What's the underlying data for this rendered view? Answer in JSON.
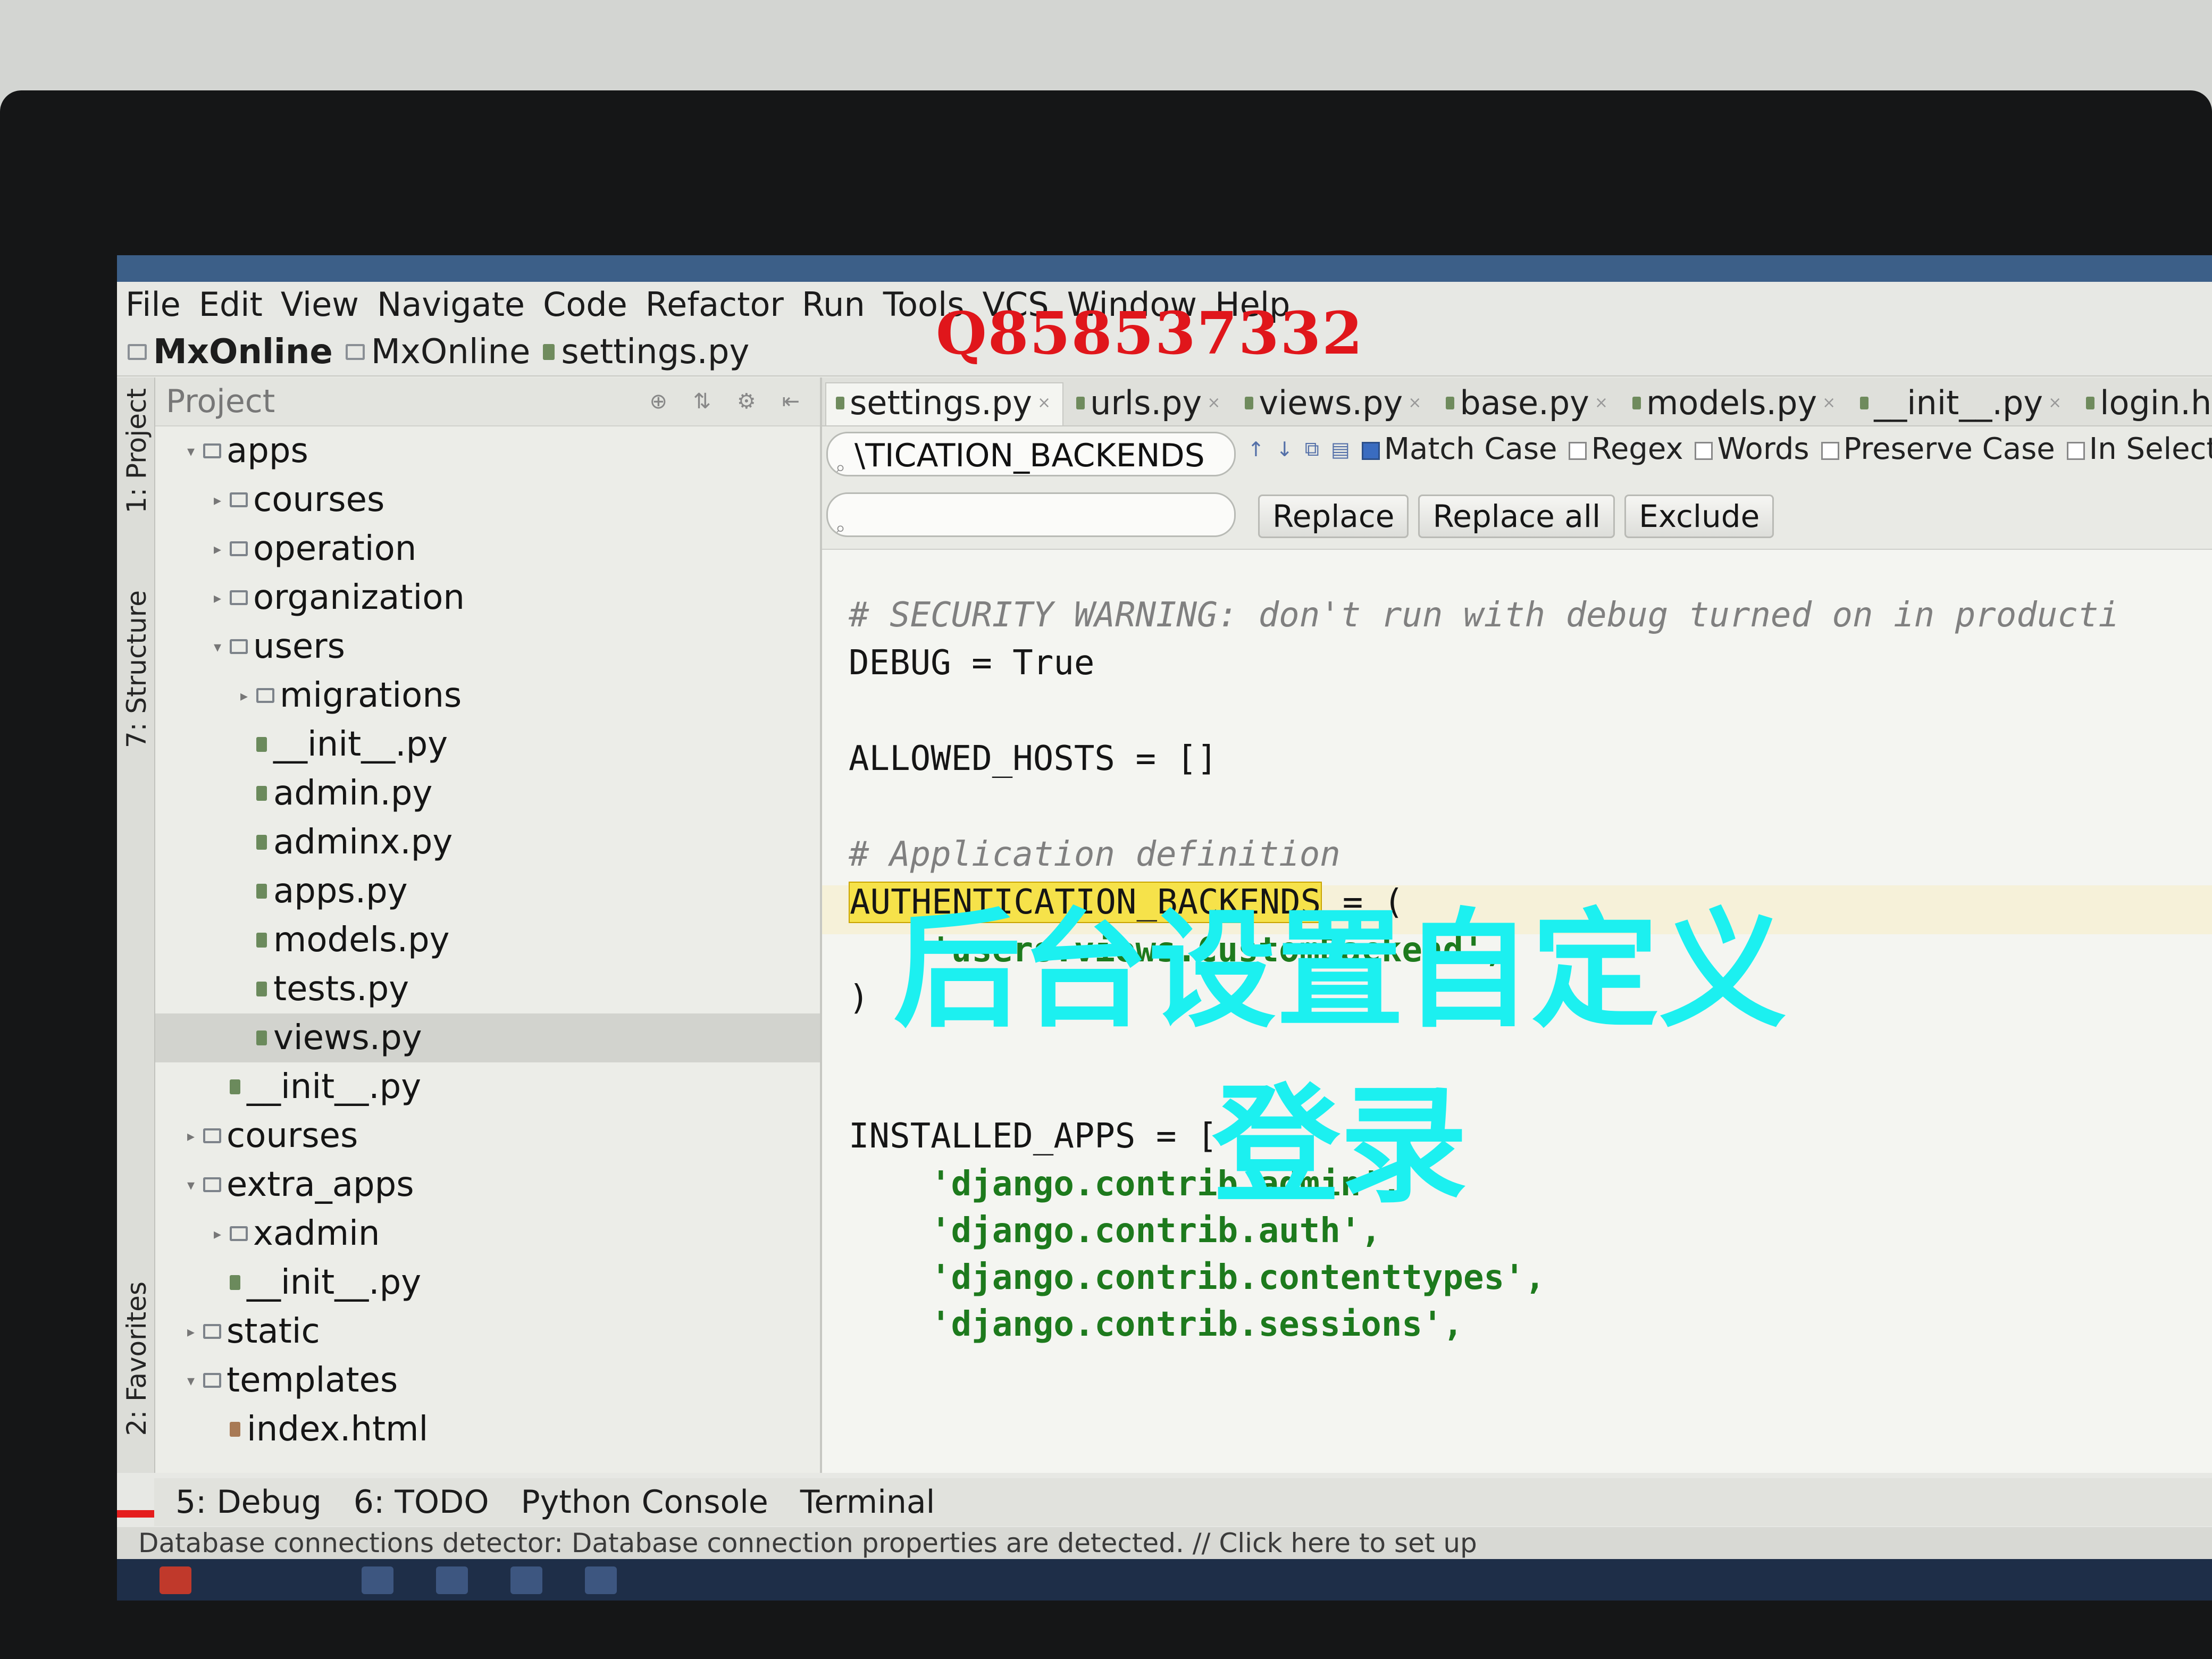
{
  "menu": [
    "File",
    "Edit",
    "View",
    "Navigate",
    "Code",
    "Refactor",
    "Run",
    "Tools",
    "VCS",
    "Window",
    "Help"
  ],
  "watermark_qq": "Q858537332",
  "breadcrumb": [
    "MxOnline",
    "MxOnline",
    "settings.py"
  ],
  "side_tabs": {
    "project": "1: Project",
    "structure": "7: Structure",
    "favorites": "2: Favorites"
  },
  "project_panel": {
    "title": "Project",
    "tree": [
      {
        "label": "apps",
        "type": "folder",
        "level": 0,
        "expanded": true
      },
      {
        "label": "courses",
        "type": "folder",
        "level": 1
      },
      {
        "label": "operation",
        "type": "folder",
        "level": 1
      },
      {
        "label": "organization",
        "type": "folder",
        "level": 1
      },
      {
        "label": "users",
        "type": "folder",
        "level": 1,
        "expanded": true
      },
      {
        "label": "migrations",
        "type": "folder",
        "level": 2
      },
      {
        "label": "__init__.py",
        "type": "file",
        "level": 2
      },
      {
        "label": "admin.py",
        "type": "file",
        "level": 2
      },
      {
        "label": "adminx.py",
        "type": "file",
        "level": 2
      },
      {
        "label": "apps.py",
        "type": "file",
        "level": 2
      },
      {
        "label": "models.py",
        "type": "file",
        "level": 2
      },
      {
        "label": "tests.py",
        "type": "file",
        "level": 2
      },
      {
        "label": "views.py",
        "type": "file",
        "level": 2,
        "selected": true
      },
      {
        "label": "__init__.py",
        "type": "file",
        "level": 1
      },
      {
        "label": "courses",
        "type": "folder",
        "level": 0
      },
      {
        "label": "extra_apps",
        "type": "folder",
        "level": 0,
        "expanded": true
      },
      {
        "label": "xadmin",
        "type": "folder",
        "level": 1
      },
      {
        "label": "__init__.py",
        "type": "file",
        "level": 1
      },
      {
        "label": "static",
        "type": "folder",
        "level": 0
      },
      {
        "label": "templates",
        "type": "folder",
        "level": 0,
        "expanded": true
      },
      {
        "label": "index.html",
        "type": "html",
        "level": 1
      }
    ]
  },
  "tabs": [
    {
      "label": "settings.py",
      "active": true
    },
    {
      "label": "urls.py"
    },
    {
      "label": "views.py"
    },
    {
      "label": "base.py"
    },
    {
      "label": "models.py"
    },
    {
      "label": "__init__.py"
    },
    {
      "label": "login.htm"
    }
  ],
  "find": {
    "search_value": "\\TICATION_BACKENDS",
    "replace_value": "",
    "options": [
      {
        "label": "Match Case",
        "checked": true
      },
      {
        "label": "Regex",
        "checked": false
      },
      {
        "label": "Words",
        "checked": false
      },
      {
        "label": "Preserve Case",
        "checked": false
      },
      {
        "label": "In Selectio",
        "checked": false
      }
    ],
    "buttons": {
      "replace": "Replace",
      "replace_all": "Replace all",
      "exclude": "Exclude"
    }
  },
  "code": {
    "security_comment": "# SECURITY WARNING: don't run with debug turned on in producti",
    "debug_line": "DEBUG = True",
    "allowed_hosts_line": "ALLOWED_HOSTS = []",
    "app_def_comment": "# Application definition",
    "auth_backends_keyword": "AUTHENTICATION_BACKENDS",
    "auth_backends_rest": " = (",
    "custom_backend_line": "    'users.views.CustomBackend',",
    "close_paren": ")",
    "installed_apps_line": "INSTALLED_APPS = [",
    "installed_apps": [
      "    'django.contrib.admin',",
      "    'django.contrib.auth',",
      "    'django.contrib.contenttypes',",
      "    'django.contrib.sessions',"
    ]
  },
  "overlay_caption": "后台设置自定义登录",
  "bottom_tools": [
    "5: Debug",
    "6: TODO",
    "Python Console",
    "Terminal"
  ],
  "status_text": "Database connections detector: Database connection properties are detected. // Click here to set up",
  "video_progress": 0.67,
  "colors": {
    "highlight": "#f6e24a",
    "overlay_text": "#1cf0f0",
    "watermark": "#e0161b",
    "string": "#1d7a1d"
  }
}
